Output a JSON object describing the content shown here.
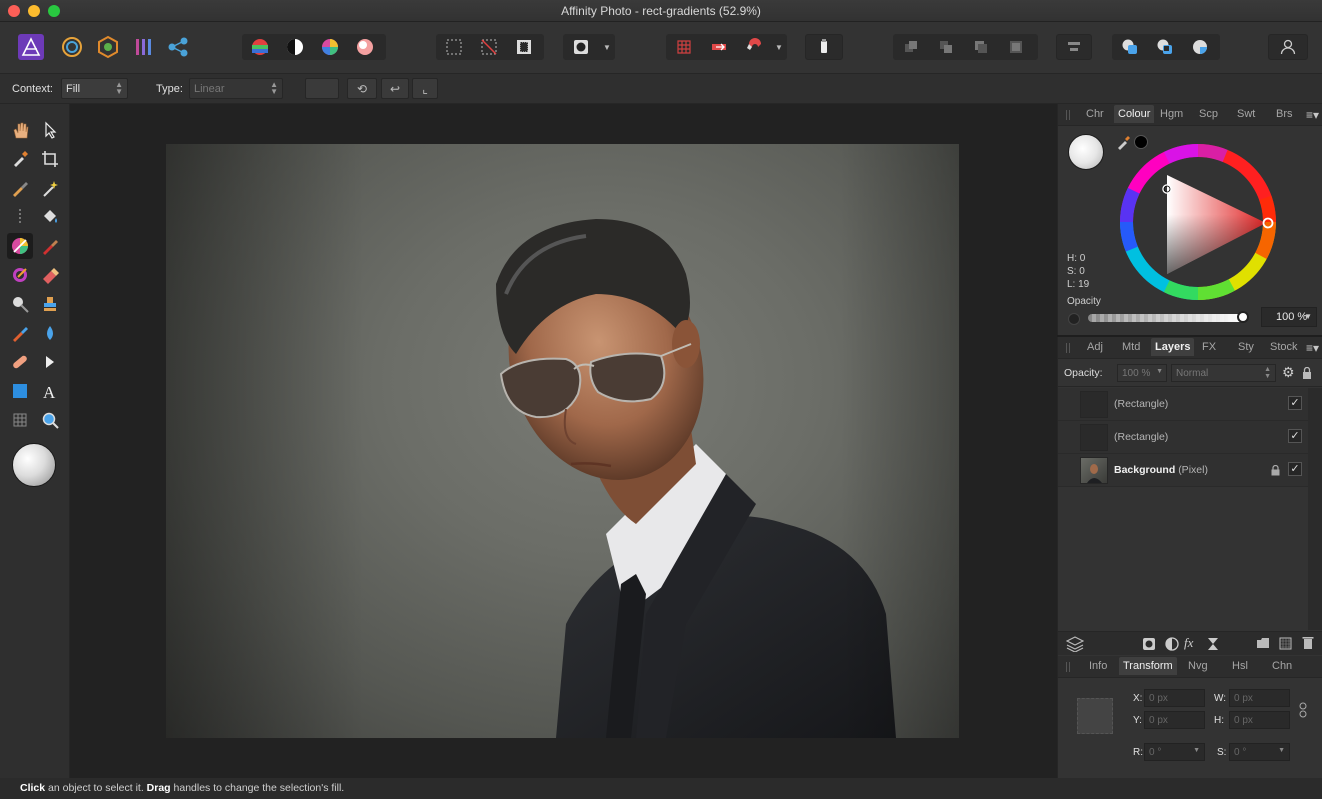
{
  "window": {
    "title": "Affinity Photo - rect-gradients (52.9%)"
  },
  "context_bar": {
    "context_label": "Context:",
    "context_value": "Fill",
    "type_label": "Type:",
    "type_value": "Linear"
  },
  "colour_panel": {
    "tabs": [
      "Chr",
      "Colour",
      "Hgm",
      "Scp",
      "Swt",
      "Brs"
    ],
    "active_tab": "Colour",
    "h": "H: 0",
    "s": "S: 0",
    "l": "L: 19",
    "opacity_label": "Opacity",
    "opacity_value": "100 %"
  },
  "layers_panel": {
    "tabs": [
      "Adj",
      "Mtd",
      "Layers",
      "FX",
      "Sty",
      "Stock"
    ],
    "active_tab": "Layers",
    "opacity_label": "Opacity:",
    "opacity_value": "100 %",
    "blend_mode": "Normal",
    "layers": [
      {
        "name": "(Rectangle)",
        "kind": ""
      },
      {
        "name": "(Rectangle)",
        "kind": ""
      },
      {
        "name": "Background",
        "kind": "(Pixel)"
      }
    ]
  },
  "transform_panel": {
    "tabs": [
      "Info",
      "Transform",
      "Nvg",
      "Hsl",
      "Chn"
    ],
    "active_tab": "Transform",
    "x_label": "X:",
    "x_value": "0 px",
    "y_label": "Y:",
    "y_value": "0 px",
    "w_label": "W:",
    "w_value": "0 px",
    "h_label": "H:",
    "h_value": "0 px",
    "r_label": "R:",
    "r_value": "0 °",
    "s_label": "S:",
    "s_value": "0 °"
  },
  "status_bar": {
    "click_word": "Click",
    "click_text": " an object to select it. ",
    "drag_word": "Drag",
    "drag_text": " handles to change the selection's fill."
  },
  "colors": {
    "accent": "#e02424",
    "panel_bg": "#333333",
    "canvas_bg": "#222222"
  }
}
